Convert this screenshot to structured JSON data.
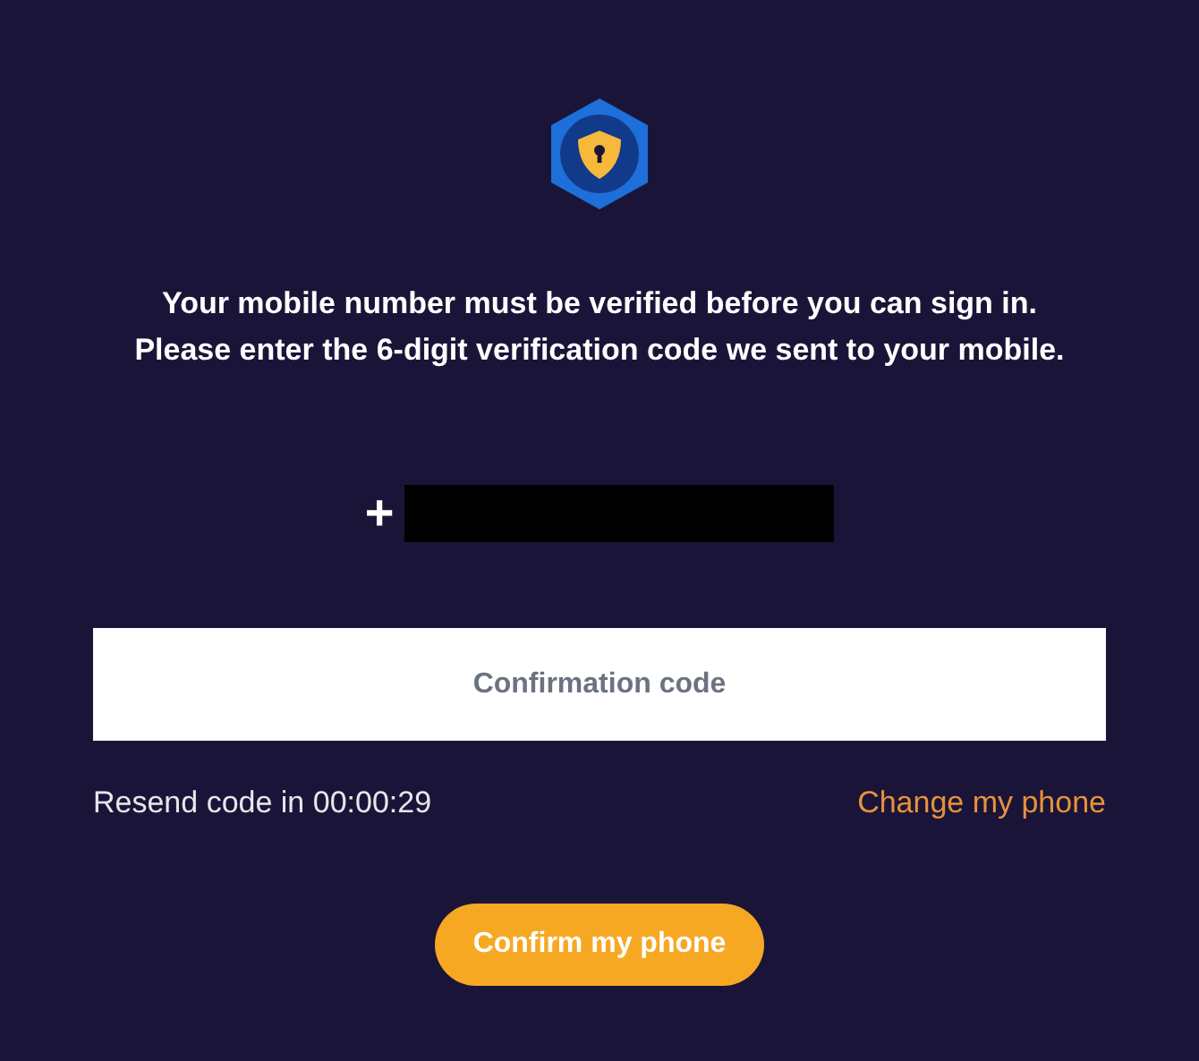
{
  "message": "Your mobile number must be verified before you can sign in. Please enter the 6-digit verification code we sent to your mobile.",
  "phone": {
    "prefix": "+",
    "redacted": true
  },
  "code_field": {
    "placeholder": "Confirmation code"
  },
  "resend": {
    "label": "Resend code in 00:00:29"
  },
  "change_link": {
    "label": "Change my phone"
  },
  "confirm_button": {
    "label": "Confirm my phone"
  }
}
